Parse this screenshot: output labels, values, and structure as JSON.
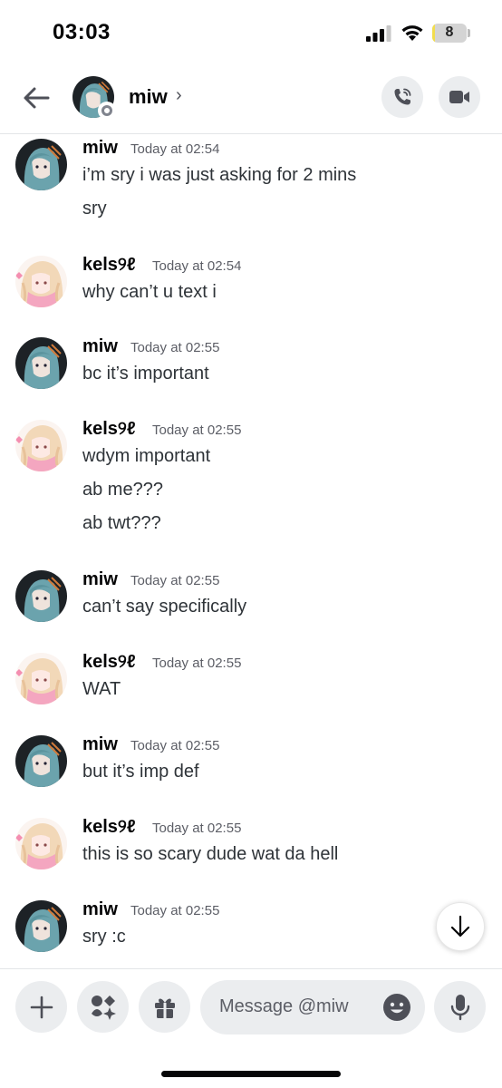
{
  "status_bar": {
    "time": "03:03",
    "battery": "8",
    "battery_level": 0.08,
    "icons": [
      "signal-icon",
      "wifi-icon",
      "battery-icon"
    ]
  },
  "header": {
    "name": "miw",
    "chevron": "›",
    "icons": [
      "back-arrow-icon",
      "phone-call-icon",
      "video-camera-icon"
    ],
    "status": "offline"
  },
  "messages": [
    {
      "author": "miw",
      "time": "Today at 02:54",
      "lines": [
        "i’m sry i was just asking for 2 mins",
        "sry"
      ]
    },
    {
      "author": "kels୨ℓ",
      "time": "Today at 02:54",
      "lines": [
        "why can’t u text i"
      ]
    },
    {
      "author": "miw",
      "time": "Today at 02:55",
      "lines": [
        "bc it’s important"
      ]
    },
    {
      "author": "kels୨ℓ",
      "time": "Today at 02:55",
      "lines": [
        "wdym important",
        "ab me???",
        "ab twt???"
      ]
    },
    {
      "author": "miw",
      "time": "Today at 02:55",
      "lines": [
        "can’t say specifically"
      ]
    },
    {
      "author": "kels୨ℓ",
      "time": "Today at 02:55",
      "lines": [
        "WAT"
      ]
    },
    {
      "author": "miw",
      "time": "Today at 02:55",
      "lines": [
        "but it’s imp def"
      ]
    },
    {
      "author": "kels୨ℓ",
      "time": "Today at 02:55",
      "lines": [
        "this is so scary dude wat da hell"
      ]
    },
    {
      "author": "miw",
      "time": "Today at 02:55",
      "lines": [
        "sry :c"
      ]
    }
  ],
  "composer": {
    "placeholder": "Message @miw",
    "icons": [
      "plus-icon",
      "apps-icon",
      "gift-icon",
      "emoji-icon",
      "microphone-icon"
    ]
  },
  "colors": {
    "background": "#ffffff",
    "button_bg": "#ebedef",
    "text_primary": "#060607",
    "text_muted": "#5c5e66",
    "offline_status": "#80848e",
    "battery_fill": "#f2dd4d"
  }
}
